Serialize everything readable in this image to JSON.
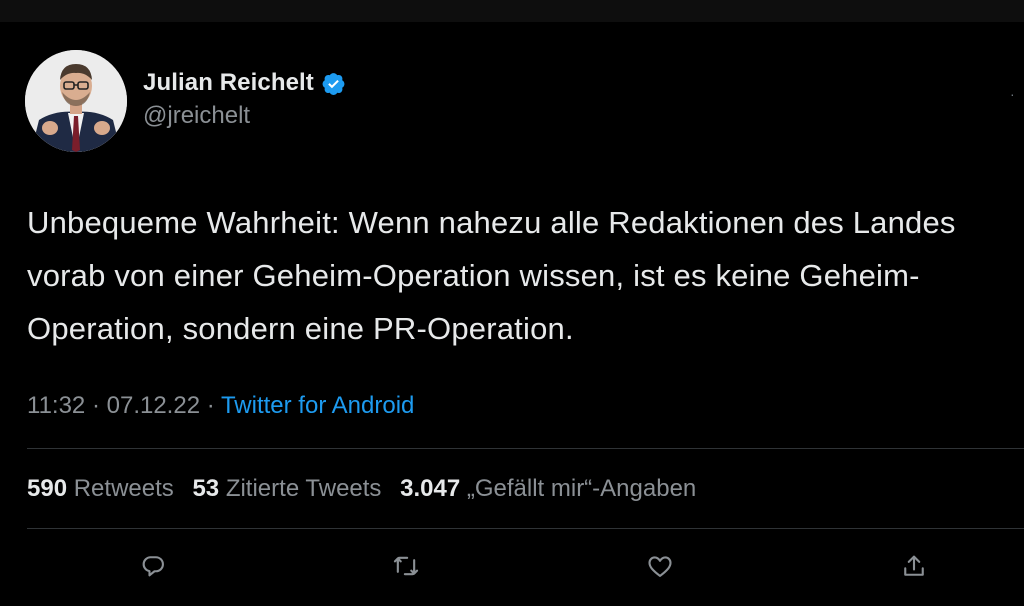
{
  "tweet": {
    "author": {
      "display_name": "Julian Reichelt",
      "handle": "@jreichelt",
      "verified": true
    },
    "text": "Unbequeme Wahrheit: Wenn nahezu alle Redaktionen des Landes vorab von einer Geheim-Operation wissen, ist es keine Geheim-Operation, sondern eine PR-Operation.",
    "time": "11:32",
    "date": "07.12.22",
    "separator": "·",
    "source": "Twitter for Android"
  },
  "stats": {
    "retweets_count": "590",
    "retweets_label": "Retweets",
    "quotes_count": "53",
    "quotes_label": "Zitierte Tweets",
    "likes_count": "3.047",
    "likes_label": "„Gefällt mir“-Angaben"
  },
  "actions": {
    "reply_icon": "reply-icon",
    "retweet_icon": "retweet-icon",
    "like_icon": "heart-icon",
    "share_icon": "share-icon"
  },
  "colors": {
    "background": "#000000",
    "text": "#e7e9ea",
    "secondary": "#8b9095",
    "link": "#1d9bf0",
    "verified": "#1d9bf0",
    "divider": "#2f3336"
  }
}
